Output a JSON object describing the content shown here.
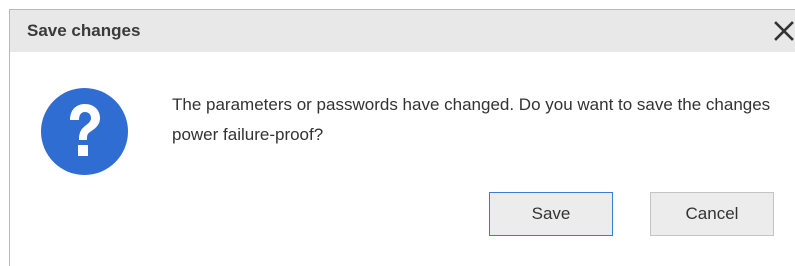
{
  "dialog": {
    "title": "Save changes",
    "close_icon": "close-icon",
    "icon": "question-icon",
    "message": "The parameters or passwords have changed. Do you want to save the changes power failure-proof?",
    "buttons": {
      "save_label": "Save",
      "cancel_label": "Cancel"
    }
  },
  "colors": {
    "titlebar": "#e8e8e8",
    "icon_blue": "#2f6dd2",
    "default_button_border": "#3d7bd4"
  }
}
